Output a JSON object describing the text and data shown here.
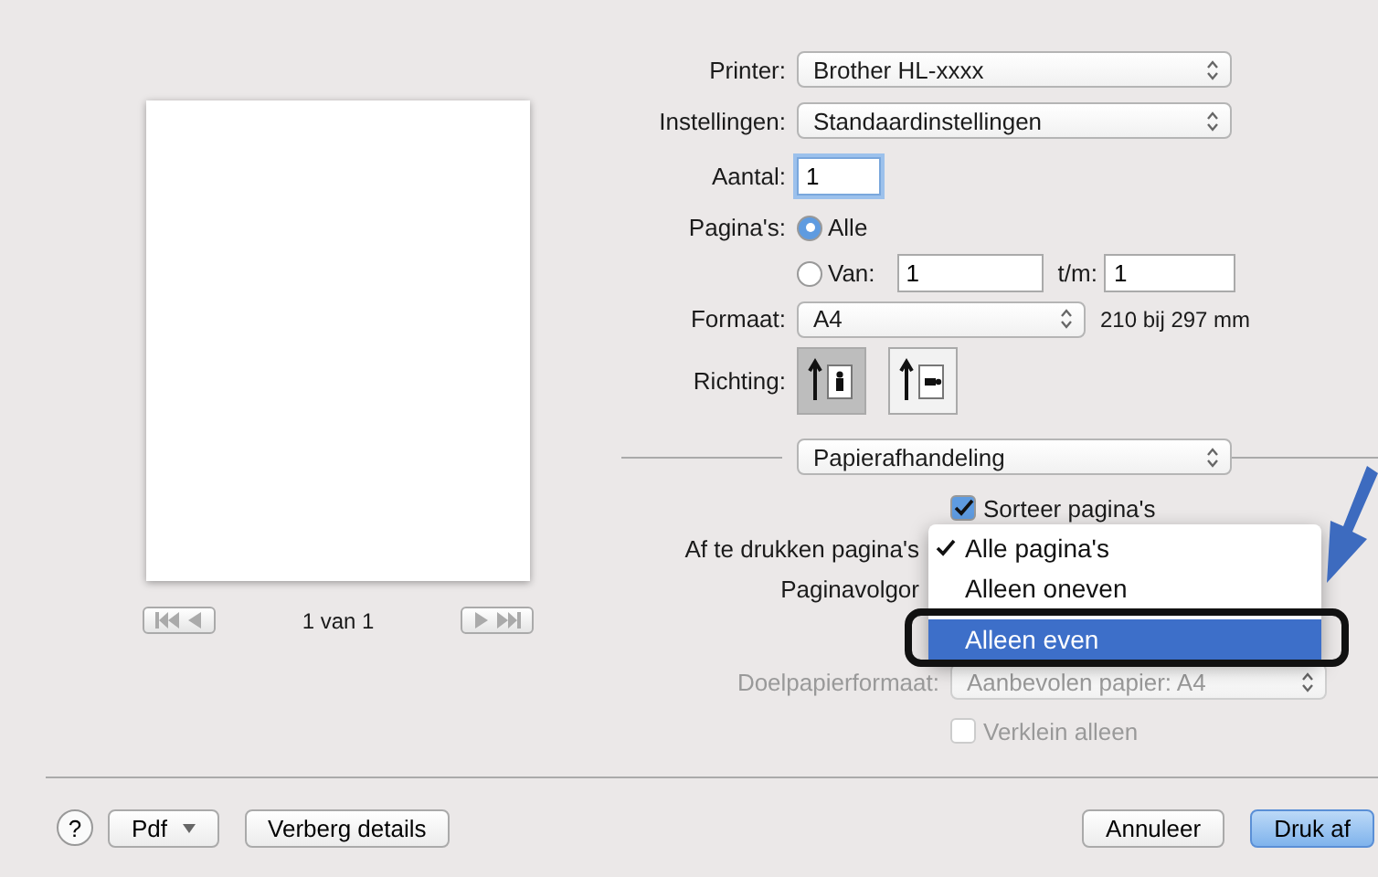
{
  "preview": {
    "page_indicator": "1 van 1"
  },
  "printer": {
    "label": "Printer:",
    "value": "Brother HL-xxxx"
  },
  "presets": {
    "label": "Instellingen:",
    "value": "Standaardinstellingen"
  },
  "copies": {
    "label": "Aantal:",
    "value": "1"
  },
  "pages": {
    "label": "Pagina's:",
    "options": [
      {
        "label": "Alle",
        "selected": true
      },
      {
        "label": "Van:",
        "selected": false
      }
    ],
    "from": "1",
    "to_label": "t/m:",
    "to": "1"
  },
  "paper_size": {
    "label": "Formaat:",
    "value": "A4",
    "dimensions": "210 bij 297 mm"
  },
  "orientation": {
    "label": "Richting:",
    "options": [
      {
        "kind": "portrait",
        "selected": true
      },
      {
        "kind": "landscape",
        "selected": false
      }
    ]
  },
  "section": {
    "value": "Papierafhandeling"
  },
  "collate": {
    "label": "Sorteer pagina's",
    "checked": true
  },
  "pages_to_print": {
    "label": "Af te drukken pagina's"
  },
  "page_order": {
    "label": "Paginavolgor"
  },
  "menu": [
    {
      "label": "Alle pagina's",
      "checked": true,
      "selected": false
    },
    {
      "label": "Alleen oneven",
      "checked": false,
      "selected": false
    },
    {
      "label": "Alleen even",
      "checked": false,
      "selected": true
    }
  ],
  "destination": {
    "label": "Doelpapierformaat:",
    "value": "Aanbevolen papier: A4",
    "disabled": true
  },
  "scale_down": {
    "label": "Verklein alleen",
    "checked": false,
    "disabled": true
  },
  "buttons": {
    "help": "?",
    "pdf": "Pdf",
    "hide": "Verberg details",
    "cancel": "Annuleer",
    "print": "Druk af"
  }
}
